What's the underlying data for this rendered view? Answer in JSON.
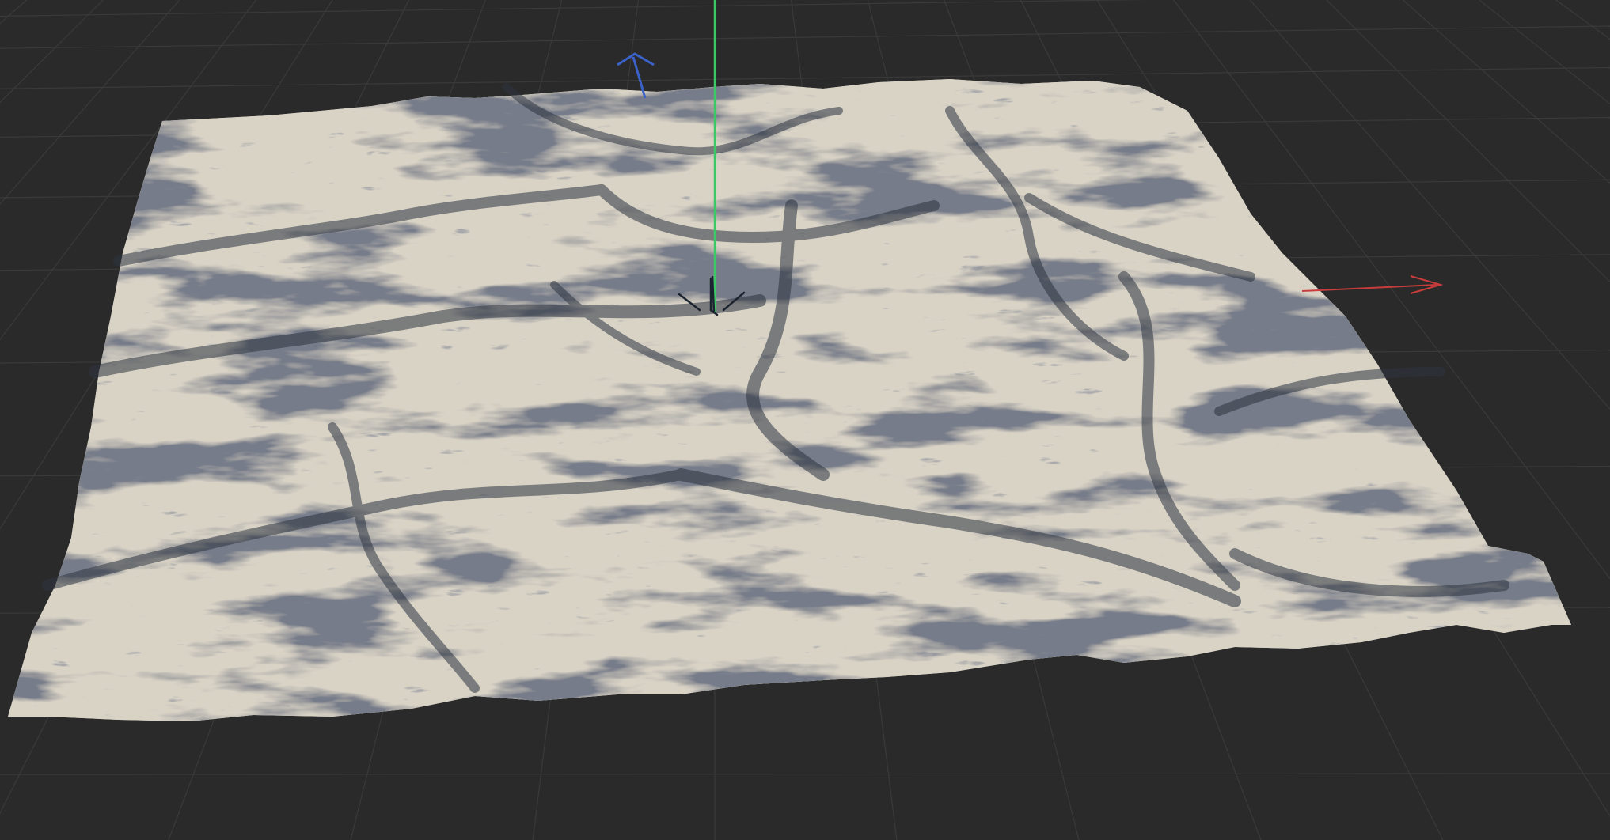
{
  "viewport": {
    "background_color": "#2a2a2a",
    "grid_color": "#3a3a3a",
    "terrain_color": "#d9d3c6",
    "terrain_shadow_color": "#2d3440"
  },
  "axes": {
    "x": {
      "color": "#c83c3c"
    },
    "y": {
      "color": "#3cc864"
    },
    "z": {
      "color": "#3a62c8"
    }
  },
  "icons": [
    "object-origin-gizmo-icon"
  ]
}
